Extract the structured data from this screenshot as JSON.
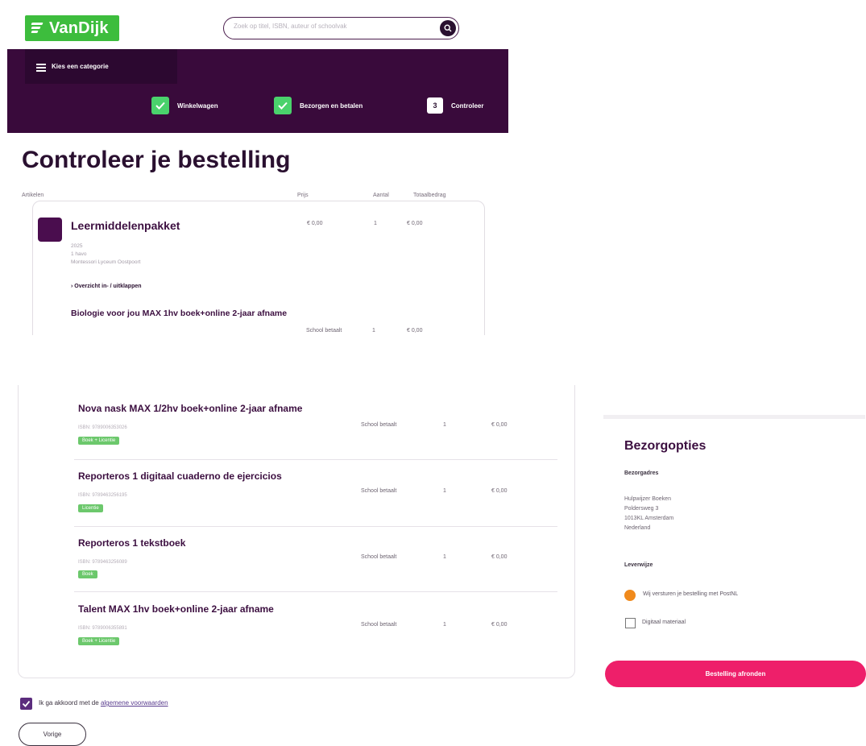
{
  "brand": {
    "name": "VanDijk"
  },
  "search": {
    "placeholder": "Zoek op titel, ISBN, auteur of schoolvak"
  },
  "nav": {
    "category_label": "Kies een categorie",
    "steps": [
      {
        "label": "Winkelwagen",
        "state": "done"
      },
      {
        "label": "Bezorgen en betalen",
        "state": "done"
      },
      {
        "label": "Controleer",
        "number": "3",
        "state": "current"
      }
    ]
  },
  "page": {
    "title": "Controleer je bestelling"
  },
  "table": {
    "headers": [
      "Artikelen",
      "Prijs",
      "Aantal",
      "Totaalbedrag"
    ]
  },
  "package": {
    "title": "Leermiddelenpakket",
    "meta": [
      "2025",
      "1 havo",
      "Montessori Lyceum Oostpoort"
    ],
    "price": "€ 0,00",
    "qty": "1",
    "total": "€ 0,00",
    "overview_link": "Overzicht in- / uitklappen"
  },
  "products": [
    {
      "title": "Biologie voor jou MAX 1hv boek+online 2-jaar afname",
      "price": "School betaalt",
      "qty": "1",
      "total": "€ 0,00"
    },
    {
      "title": "Nova nask MAX 1/2hv boek+online 2-jaar afname",
      "isbn": "ISBN: 9789006353026",
      "tag": "Boek + Licentie",
      "price": "School betaalt",
      "qty": "1",
      "total": "€ 0,00"
    },
    {
      "title": "Reporteros 1 digitaal cuaderno de ejercicios",
      "isbn": "ISBN: 9789463256195",
      "tag": "Licentie",
      "price": "School betaalt",
      "qty": "1",
      "total": "€ 0,00"
    },
    {
      "title": "Reporteros 1 tekstboek",
      "isbn": "ISBN: 9789463256089",
      "tag": "Boek",
      "price": "School betaalt",
      "qty": "1",
      "total": "€ 0,00"
    },
    {
      "title": "Talent MAX 1hv boek+online 2-jaar afname",
      "isbn": "ISBN: 9789006355891",
      "tag": "Boek + Licentie",
      "price": "School betaalt",
      "qty": "1",
      "total": "€ 0,00"
    }
  ],
  "delivery": {
    "title": "Bezorgopties",
    "address_label": "Bezorgadres",
    "address_lines": [
      "Hulpwijzer Boeken",
      "Poldersweg 3",
      "1013KL Amsterdam",
      "Nederland"
    ],
    "method_label": "Leverwijze",
    "methods": [
      {
        "icon": "postnl-icon",
        "label": "Wij versturen je bestelling met PostNL"
      },
      {
        "icon": "digital-material-icon",
        "label": "Digitaal materiaal"
      }
    ]
  },
  "actions": {
    "order_button": "Bestelling afronden",
    "agree_text": "Ik ga akkoord met de",
    "agree_link": "algemene voorwaarden",
    "prev_button": "Vorige"
  },
  "colors": {
    "brand_green": "#3dbd3d",
    "nav_purple": "#390a3b",
    "cta_pink": "#ee1f6a",
    "step_green": "#4ad26c"
  }
}
